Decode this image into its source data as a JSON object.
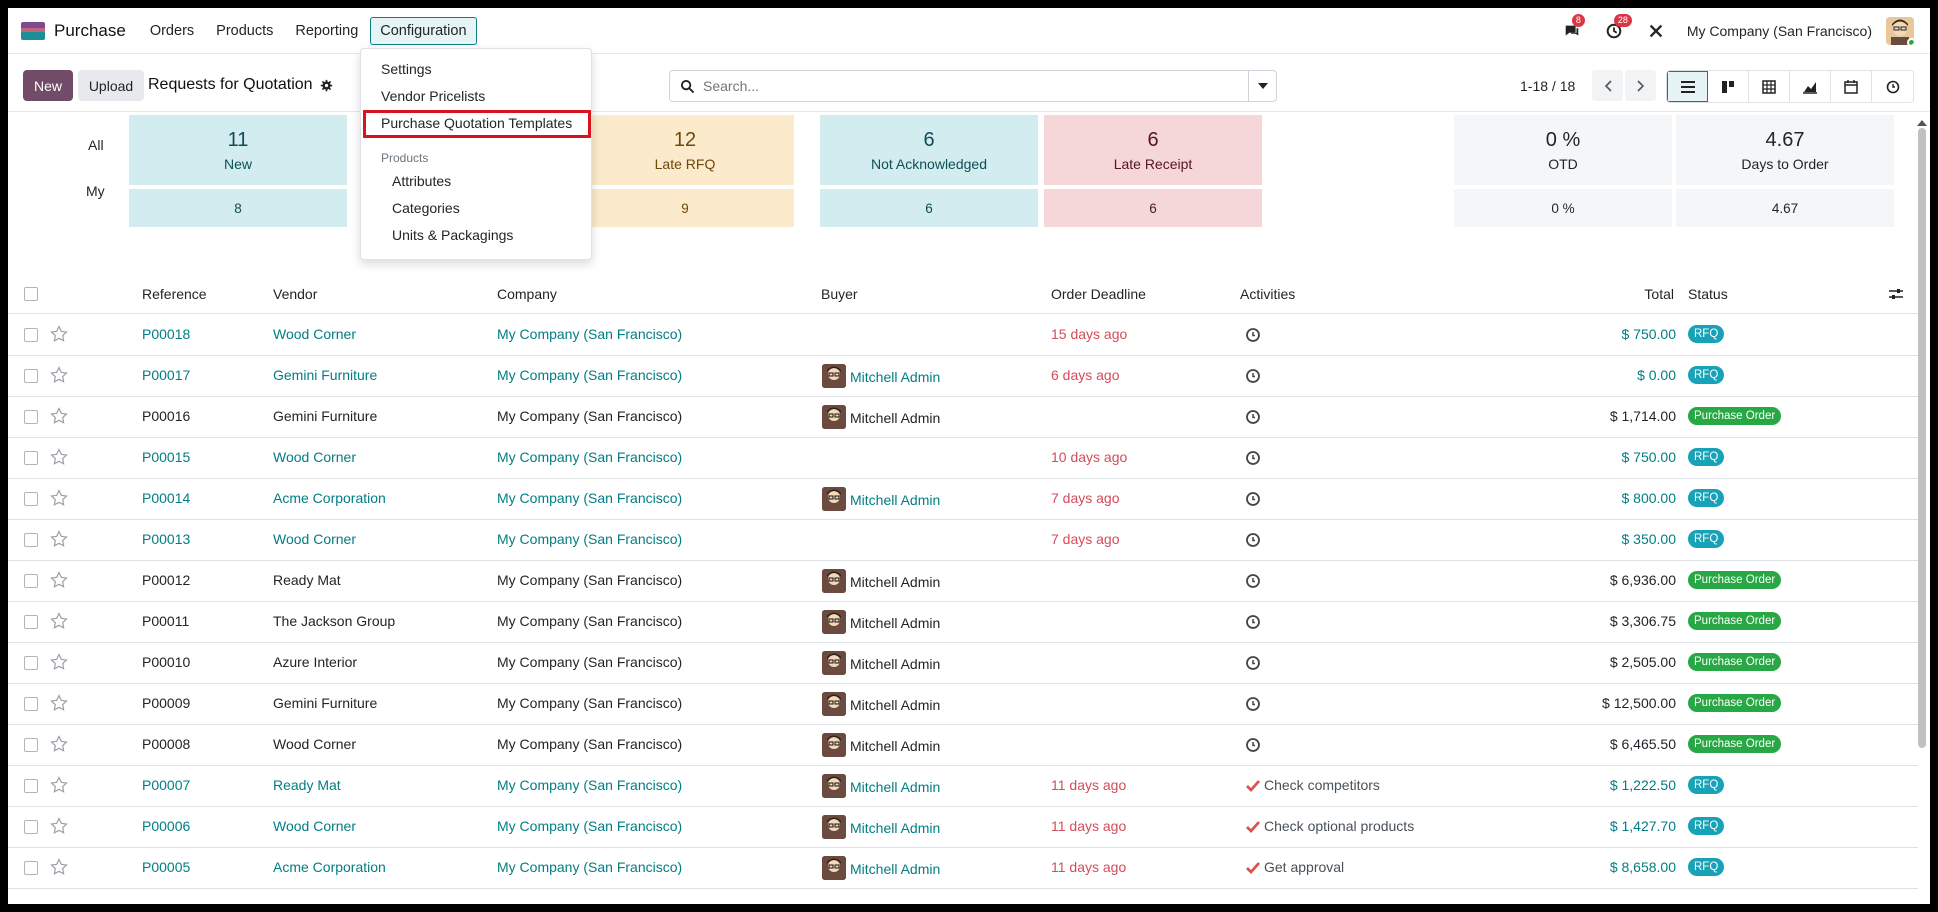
{
  "app": {
    "name": "Purchase"
  },
  "menu": [
    "Orders",
    "Products",
    "Reporting",
    "Configuration"
  ],
  "navbar": {
    "messages_badge": "8",
    "activities_badge": "28",
    "company": "My Company (San Francisco)"
  },
  "control": {
    "new_label": "New",
    "upload_label": "Upload",
    "title": "Requests for Quotation",
    "search_placeholder": "Search...",
    "pager": "1-18 / 18"
  },
  "config_menu": {
    "items": [
      "Settings",
      "Vendor Pricelists",
      "Purchase Quotation Templates"
    ],
    "section": "Products",
    "sub_items": [
      "Attributes",
      "Categories",
      "Units & Packagings"
    ]
  },
  "dashboard": {
    "row_all": "All",
    "row_my": "My",
    "cards": [
      {
        "num": "11",
        "label": "New",
        "my": "8"
      },
      {
        "num": "12",
        "label": "Late RFQ",
        "my": "9"
      },
      {
        "num": "6",
        "label": "Not Acknowledged",
        "my": "6"
      },
      {
        "num": "6",
        "label": "Late Receipt",
        "my": "6"
      }
    ],
    "kpis": [
      {
        "num": "0 %",
        "label": "OTD",
        "my": "0 %"
      },
      {
        "num": "4.67",
        "label": "Days to Order",
        "my": "4.67"
      }
    ]
  },
  "table": {
    "headers": {
      "reference": "Reference",
      "vendor": "Vendor",
      "company": "Company",
      "buyer": "Buyer",
      "deadline": "Order Deadline",
      "activities": "Activities",
      "total": "Total",
      "status": "Status"
    },
    "rows": [
      {
        "ref": "P00018",
        "vendor": "Wood Corner",
        "company": "My Company (San Francisco)",
        "buyer": "",
        "deadline": "15 days ago",
        "activity": "",
        "total": "$ 750.00",
        "status": "RFQ"
      },
      {
        "ref": "P00017",
        "vendor": "Gemini Furniture",
        "company": "My Company (San Francisco)",
        "buyer": "Mitchell Admin",
        "deadline": "6 days ago",
        "activity": "",
        "total": "$ 0.00",
        "status": "RFQ"
      },
      {
        "ref": "P00016",
        "vendor": "Gemini Furniture",
        "company": "My Company (San Francisco)",
        "buyer": "Mitchell Admin",
        "deadline": "",
        "activity": "",
        "total": "$ 1,714.00",
        "status": "Purchase Order"
      },
      {
        "ref": "P00015",
        "vendor": "Wood Corner",
        "company": "My Company (San Francisco)",
        "buyer": "",
        "deadline": "10 days ago",
        "activity": "",
        "total": "$ 750.00",
        "status": "RFQ"
      },
      {
        "ref": "P00014",
        "vendor": "Acme Corporation",
        "company": "My Company (San Francisco)",
        "buyer": "Mitchell Admin",
        "deadline": "7 days ago",
        "activity": "",
        "total": "$ 800.00",
        "status": "RFQ"
      },
      {
        "ref": "P00013",
        "vendor": "Wood Corner",
        "company": "My Company (San Francisco)",
        "buyer": "",
        "deadline": "7 days ago",
        "activity": "",
        "total": "$ 350.00",
        "status": "RFQ"
      },
      {
        "ref": "P00012",
        "vendor": "Ready Mat",
        "company": "My Company (San Francisco)",
        "buyer": "Mitchell Admin",
        "deadline": "",
        "activity": "",
        "total": "$ 6,936.00",
        "status": "Purchase Order"
      },
      {
        "ref": "P00011",
        "vendor": "The Jackson Group",
        "company": "My Company (San Francisco)",
        "buyer": "Mitchell Admin",
        "deadline": "",
        "activity": "",
        "total": "$ 3,306.75",
        "status": "Purchase Order"
      },
      {
        "ref": "P00010",
        "vendor": "Azure Interior",
        "company": "My Company (San Francisco)",
        "buyer": "Mitchell Admin",
        "deadline": "",
        "activity": "",
        "total": "$ 2,505.00",
        "status": "Purchase Order"
      },
      {
        "ref": "P00009",
        "vendor": "Gemini Furniture",
        "company": "My Company (San Francisco)",
        "buyer": "Mitchell Admin",
        "deadline": "",
        "activity": "",
        "total": "$ 12,500.00",
        "status": "Purchase Order"
      },
      {
        "ref": "P00008",
        "vendor": "Wood Corner",
        "company": "My Company (San Francisco)",
        "buyer": "Mitchell Admin",
        "deadline": "",
        "activity": "",
        "total": "$ 6,465.50",
        "status": "Purchase Order"
      },
      {
        "ref": "P00007",
        "vendor": "Ready Mat",
        "company": "My Company (San Francisco)",
        "buyer": "Mitchell Admin",
        "deadline": "11 days ago",
        "activity": "Check competitors",
        "total": "$ 1,222.50",
        "status": "RFQ"
      },
      {
        "ref": "P00006",
        "vendor": "Wood Corner",
        "company": "My Company (San Francisco)",
        "buyer": "Mitchell Admin",
        "deadline": "11 days ago",
        "activity": "Check optional products",
        "total": "$ 1,427.70",
        "status": "RFQ"
      },
      {
        "ref": "P00005",
        "vendor": "Acme Corporation",
        "company": "My Company (San Francisco)",
        "buyer": "Mitchell Admin",
        "deadline": "11 days ago",
        "activity": "Get approval",
        "total": "$ 8,658.00",
        "status": "RFQ"
      }
    ]
  },
  "colors": {
    "primary": "#714b67",
    "link": "#017e84",
    "late": "#d44c59",
    "rfq": "#17a2b8",
    "purchase_order": "#28a745"
  }
}
